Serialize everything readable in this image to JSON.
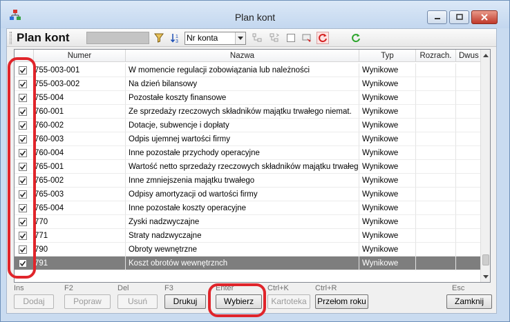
{
  "window": {
    "title": "Plan kont"
  },
  "toolbar": {
    "title": "Plan kont",
    "sort_select": {
      "value": "Nr konta"
    }
  },
  "grid": {
    "columns": [
      "",
      "Numer",
      "Nazwa",
      "Typ",
      "Rozrach.",
      "Dwus"
    ],
    "rows": [
      {
        "checked": true,
        "numer": "755-003-001",
        "nazwa": "W momencie regulacji zobowiązania lub należności",
        "typ": "Wynikowe"
      },
      {
        "checked": true,
        "numer": "755-003-002",
        "nazwa": "Na dzień bilansowy",
        "typ": "Wynikowe"
      },
      {
        "checked": true,
        "numer": "755-004",
        "nazwa": "Pozostałe koszty finansowe",
        "typ": "Wynikowe"
      },
      {
        "checked": true,
        "numer": "760-001",
        "nazwa": "Ze sprzedaży rzeczowych składników majątku trwałego niemat.",
        "typ": "Wynikowe"
      },
      {
        "checked": true,
        "numer": "760-002",
        "nazwa": "Dotacje, subwencje i dopłaty",
        "typ": "Wynikowe"
      },
      {
        "checked": true,
        "numer": "760-003",
        "nazwa": "Odpis ujemnej wartości firmy",
        "typ": "Wynikowe"
      },
      {
        "checked": true,
        "numer": "760-004",
        "nazwa": "Inne pozostałe przychody operacyjne",
        "typ": "Wynikowe"
      },
      {
        "checked": true,
        "numer": "765-001",
        "nazwa": "Wartość netto sprzedaży rzeczowych składników majątku trwałego",
        "typ": "Wynikowe"
      },
      {
        "checked": true,
        "numer": "765-002",
        "nazwa": "Inne zmniejszenia majątku trwałego",
        "typ": "Wynikowe"
      },
      {
        "checked": true,
        "numer": "765-003",
        "nazwa": "Odpisy amortyzacji od wartości firmy",
        "typ": "Wynikowe"
      },
      {
        "checked": true,
        "numer": "765-004",
        "nazwa": "Inne pozostałe koszty operacyjne",
        "typ": "Wynikowe"
      },
      {
        "checked": true,
        "numer": "770",
        "nazwa": "Zyski nadzwyczajne",
        "typ": "Wynikowe"
      },
      {
        "checked": true,
        "numer": "771",
        "nazwa": "Straty nadzwyczajne",
        "typ": "Wynikowe"
      },
      {
        "checked": true,
        "numer": "790",
        "nazwa": "Obroty wewnętrzne",
        "typ": "Wynikowe"
      },
      {
        "checked": true,
        "numer": "791",
        "nazwa": "Koszt obrotów wewnętrznch",
        "typ": "Wynikowe",
        "selected": true
      }
    ]
  },
  "buttons": [
    {
      "key": "dodaj",
      "hotkey": "Ins",
      "label": "Dodaj",
      "enabled": false
    },
    {
      "key": "popraw",
      "hotkey": "F2",
      "label": "Popraw",
      "enabled": false
    },
    {
      "key": "usun",
      "hotkey": "Del",
      "label": "Usuń",
      "enabled": false
    },
    {
      "key": "drukuj",
      "hotkey": "F3",
      "label": "Drukuj",
      "enabled": true
    },
    {
      "key": "wybierz",
      "hotkey": "Enter",
      "label": "Wybierz",
      "enabled": true
    },
    {
      "key": "kartoteka",
      "hotkey": "Ctrl+K",
      "label": "Kartoteka",
      "enabled": false
    },
    {
      "key": "przelom-roku",
      "hotkey": "Ctrl+R",
      "label": "Przełom roku",
      "enabled": true
    },
    {
      "key": "zamknij",
      "hotkey": "Esc",
      "label": "Zamknij",
      "enabled": true
    }
  ],
  "colors": {
    "annotation": "#e0252b",
    "selected_row": "#7e7e7e",
    "title_bar": "#c9dbf0"
  }
}
